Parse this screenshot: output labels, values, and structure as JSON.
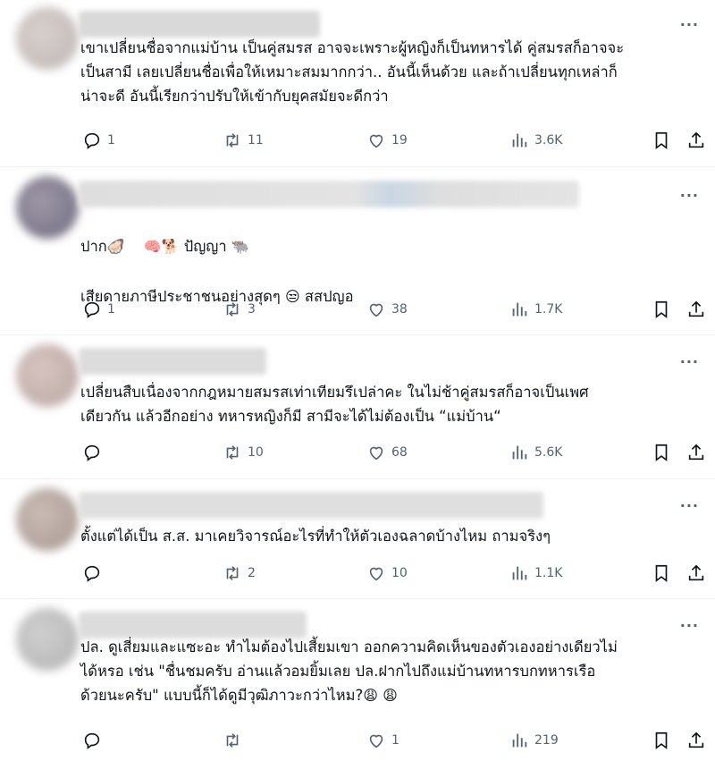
{
  "posts": [
    {
      "text": "เขาเปลี่ยนชื่อจากแม่บ้าน เป็นคู่สมรส อาจจะเพราะผู้หญิงก็เป็นทหารได้ คู่สมรสก็อาจจะ\nเป็นสามี เลยเปลี่ยนชื่อเพื่อให้เหมาะสมมากกว่า.. อันนี้เห็นด้วย และถ้าเปลี่ยนทุกเหล่าก็\nน่าจะดี อันนี้เรียกว่าปรับให้เข้ากับยุคสมัยจะดีกว่า",
      "replies": "1",
      "reposts": "11",
      "likes": "19",
      "views": "3.6K"
    },
    {
      "line1_prefix": "ปาก",
      "line1_mid": "ปัญญา",
      "line2": "เสียดายภาษีประชาชนอย่างสุดๆ",
      "line2_suffix": "สสปญอ",
      "emoji_oyster": "🦪",
      "emoji_brain": "🧠",
      "emoji_dog": "🐕",
      "emoji_buffalo": "🐃",
      "emoji_face": "😒",
      "replies": "1",
      "reposts": "3",
      "likes": "38",
      "views": "1.7K"
    },
    {
      "text": "เปลี่ยนสืบเนื่องจากกฎหมายสมรสเท่าเทียมรึเปล่าคะ ในไม่ช้าคู่สมรสก็อาจเป็นเพศ\nเดียวกัน แล้วอีกอย่าง ทหารหญิงก็มี สามีจะได้ไม่ต้องเป็น “แม่บ้าน“",
      "replies": "",
      "reposts": "10",
      "likes": "68",
      "views": "5.6K"
    },
    {
      "text": "ตั้งแต่ได้เป็น ส.ส. มาเคยวิจารณ์อะไรที่ทำให้ตัวเองฉลาดบ้างไหม ถามจริงๆ",
      "replies": "",
      "reposts": "2",
      "likes": "10",
      "views": "1.1K"
    },
    {
      "text": "ปล. ดูเสี่ยมและแซะอะ ทำไมต้องไปเสี้ยมเขา ออกความคิดเห็นของตัวเองอย่างเดียวไม่\nได้หรอ เช่น \"ชื่นชมครับ อ่านแล้วอมยิ้มเลย ปล.ฝากไปถึงแม่บ้านทหารบกทหารเรือ\nด้วยนะครับ\" แบบนี้ก็ได้ดูมีวุฒิภาวะกว่าไหม?",
      "emoji_weary": "😩",
      "replies": "",
      "reposts": "",
      "likes": "1",
      "views": "219"
    }
  ],
  "ui": {
    "more_label": "···"
  },
  "icons": {
    "reply": "reply-icon",
    "repost": "repost-icon",
    "like": "like-icon",
    "views": "views-icon",
    "bookmark": "bookmark-icon",
    "share": "share-icon"
  }
}
